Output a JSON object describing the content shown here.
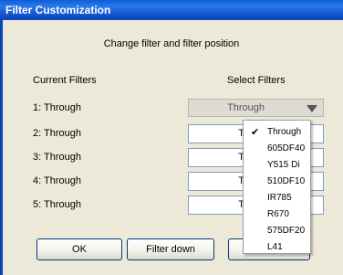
{
  "window": {
    "title": "Filter Customization"
  },
  "dialog": {
    "subtitle": "Change filter and filter position",
    "current_header": "Current Filters",
    "select_header": "Select Filters"
  },
  "rows": [
    {
      "label": "1: Through",
      "selected": "Through"
    },
    {
      "label": "2: Through",
      "selected": "Thr"
    },
    {
      "label": "3: Through",
      "selected": "Thr"
    },
    {
      "label": "4: Through",
      "selected": "Thr"
    },
    {
      "label": "5: Through",
      "selected": "Thr"
    }
  ],
  "dropdown": {
    "checked_item": "Through",
    "check_glyph": "✔",
    "options": [
      "Through",
      "605DF40",
      "Y515 Di",
      "510DF10",
      "IR785",
      "R670",
      "575DF20",
      "L41"
    ]
  },
  "buttons": {
    "ok": "OK",
    "filter_down": "Filter down",
    "third": ""
  },
  "colors": {
    "title_bar": "#0a5fd8",
    "dialog_bg": "#ece9d8",
    "button_border": "#003c74"
  }
}
